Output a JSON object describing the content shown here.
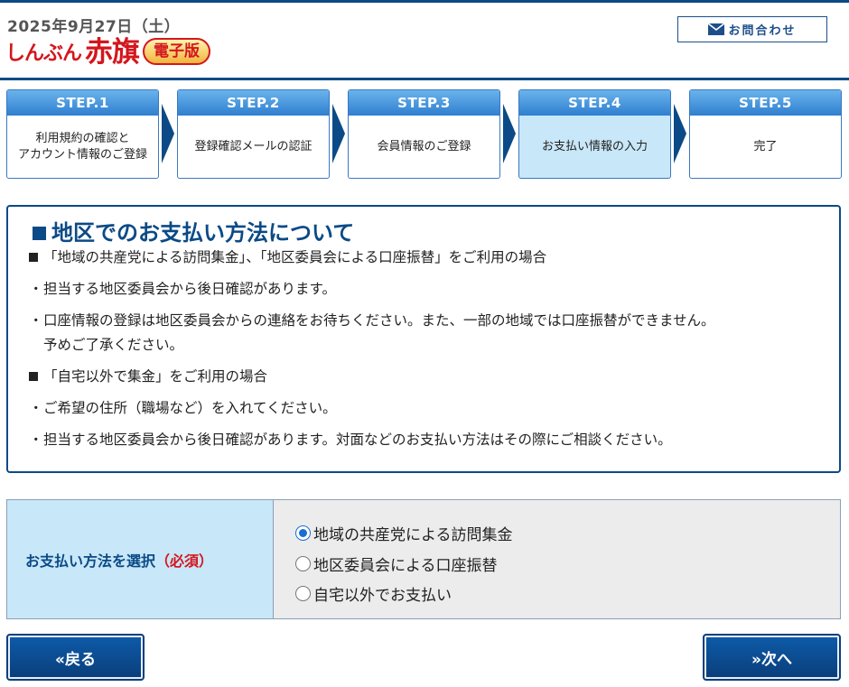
{
  "header": {
    "date": "2025年9月27日（土）",
    "logo_hiragana": "しんぶん",
    "logo_kanji": "赤旗",
    "logo_badge": "電子版",
    "contact_label": "お問合わせ"
  },
  "steps": [
    {
      "head": "STEP.1",
      "body": "利用規約の確認と\nアカウント情報のご登録",
      "active": false
    },
    {
      "head": "STEP.2",
      "body": "登録確認メールの認証",
      "active": false
    },
    {
      "head": "STEP.3",
      "body": "会員情報のご登録",
      "active": false
    },
    {
      "head": "STEP.4",
      "body": "お支払い情報の入力",
      "active": true
    },
    {
      "head": "STEP.5",
      "body": "完了",
      "active": false
    }
  ],
  "info": {
    "title": "地区でのお支払い方法について",
    "section1_heading": "「地域の共産党による訪問集金」、「地区委員会による口座振替」をご利用の場合",
    "section1_bullet1": "担当する地区委員会から後日確認があります。",
    "section1_bullet2_line1": "口座情報の登録は地区委員会からの連絡をお待ちください。また、一部の地域では口座振替ができません。",
    "section1_bullet2_line2": "予めご了承ください。",
    "section2_heading": "「自宅以外で集金」をご利用の場合",
    "section2_bullet1": "ご希望の住所（職場など）を入れてください。",
    "section2_bullet2": "担当する地区委員会から後日確認があります。対面などのお支払い方法はその際にご相談ください。",
    "bullet_mark": "・"
  },
  "payment": {
    "label": "お支払い方法を選択",
    "required": "（必須）",
    "options": [
      {
        "label": "地域の共産党による訪問集金",
        "selected": true
      },
      {
        "label": "地区委員会による口座振替",
        "selected": false
      },
      {
        "label": "自宅以外でお支払い",
        "selected": false
      }
    ]
  },
  "nav": {
    "back_label": "«戻る",
    "next_label": "»次へ"
  },
  "colors": {
    "brand_navy": "#0b4a86",
    "logo_red": "#d4161d",
    "active_step_bg": "#c8e7f8"
  }
}
